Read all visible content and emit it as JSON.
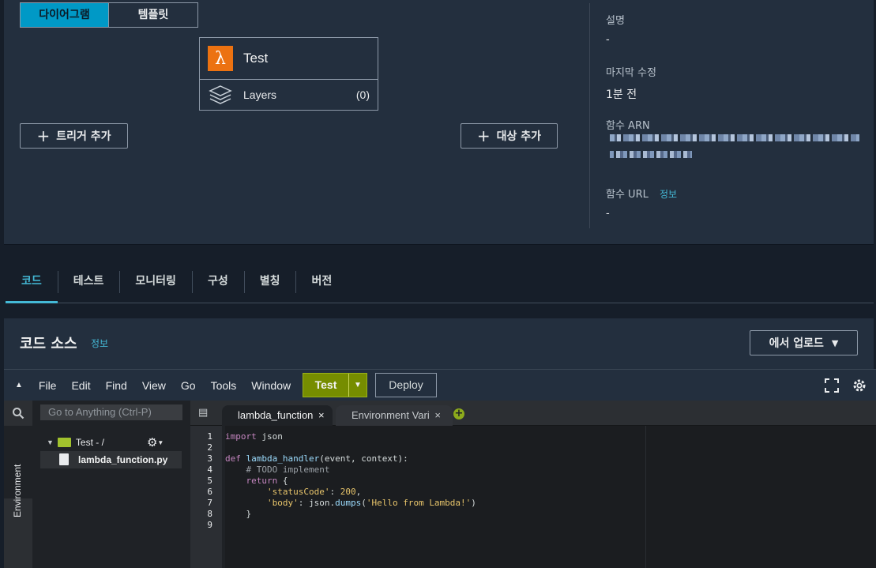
{
  "overview": {
    "view_toggle": {
      "diagram": "다이어그램",
      "template": "템플릿"
    },
    "function": {
      "name": "Test",
      "layers_label": "Layers",
      "layers_count": "(0)"
    },
    "add_trigger": "트리거 추가",
    "add_destination": "대상 추가",
    "details": {
      "description_label": "설명",
      "description_value": "-",
      "modified_label": "마지막 수정",
      "modified_value": "1분 전",
      "arn_label": "함수 ARN",
      "url_label": "함수 URL",
      "url_info": "정보",
      "url_value": "-"
    }
  },
  "tabs": [
    "코드",
    "테스트",
    "모니터링",
    "구성",
    "별칭",
    "버전"
  ],
  "code_source": {
    "title": "코드 소스",
    "info": "정보",
    "upload_button": "에서 업로드"
  },
  "ide": {
    "menu": [
      "File",
      "Edit",
      "Find",
      "View",
      "Go",
      "Tools",
      "Window"
    ],
    "test_button": "Test",
    "deploy_button": "Deploy",
    "goto_placeholder": "Go to Anything (Ctrl-P)",
    "environment_label": "Environment",
    "tree_root": "Test - /",
    "tree_file": "lambda_function.py",
    "editor_tabs": [
      "lambda_function",
      "Environment Vari"
    ],
    "line_numbers": [
      "1",
      "2",
      "3",
      "4",
      "5",
      "6",
      "7",
      "8",
      "9"
    ]
  },
  "colors": {
    "accent": "#44b9d6",
    "lambda_orange": "#ec7211",
    "test_green": "#768d00"
  }
}
